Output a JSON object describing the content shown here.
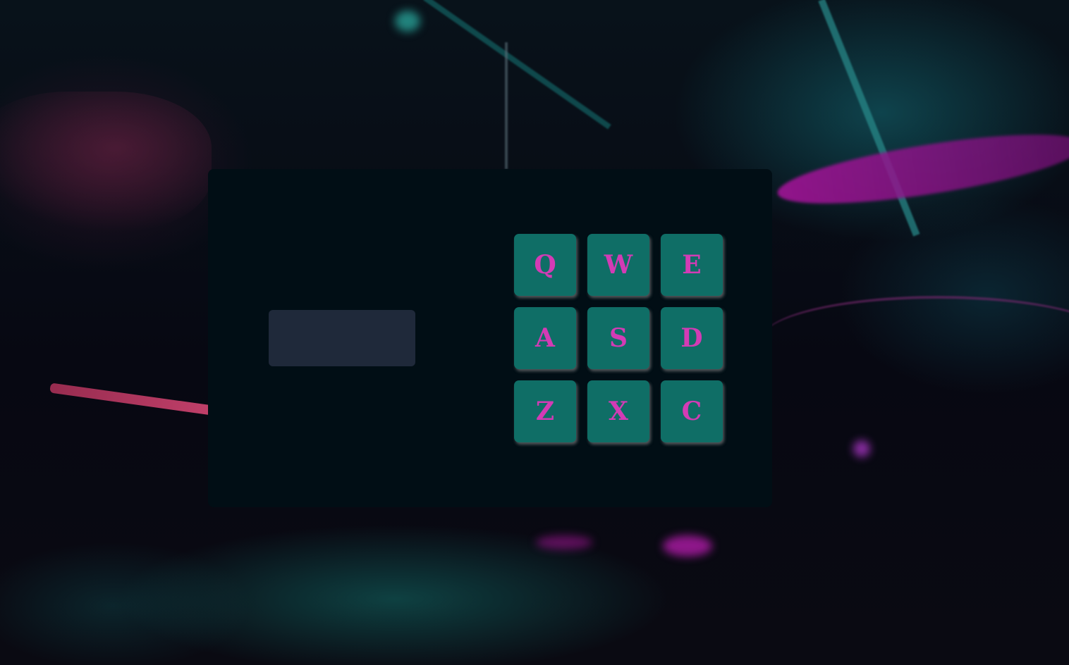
{
  "display": {
    "text": ""
  },
  "pads": [
    {
      "key": "Q"
    },
    {
      "key": "W"
    },
    {
      "key": "E"
    },
    {
      "key": "A"
    },
    {
      "key": "S"
    },
    {
      "key": "D"
    },
    {
      "key": "Z"
    },
    {
      "key": "X"
    },
    {
      "key": "C"
    }
  ],
  "colors": {
    "panel": "#010e15",
    "display": "#1f293a",
    "pad": "#0f6e66",
    "pad_text": "#d33bb5"
  }
}
